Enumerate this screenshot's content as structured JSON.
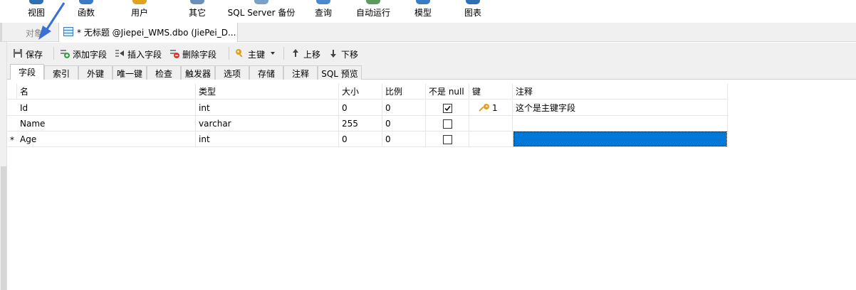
{
  "ribbon": {
    "items": [
      {
        "label": "视图",
        "icon": "view-icon"
      },
      {
        "label": "函数",
        "icon": "function-icon"
      },
      {
        "label": "用户",
        "icon": "user-icon"
      },
      {
        "label": "其它",
        "icon": "other-icon"
      },
      {
        "label": "SQL Server 备份",
        "icon": "backup-icon"
      },
      {
        "label": "查询",
        "icon": "query-icon"
      },
      {
        "label": "自动运行",
        "icon": "automation-icon"
      },
      {
        "label": "模型",
        "icon": "model-icon"
      },
      {
        "label": "图表",
        "icon": "chart-icon"
      }
    ]
  },
  "tabs": {
    "objects_label": "对象",
    "document_label": "* 无标题 @Jiepei_WMS.dbo (JiePei_D..."
  },
  "toolbar": {
    "save": "保存",
    "add_field": "添加字段",
    "insert_field": "插入字段",
    "delete_field": "删除字段",
    "primary_key": "主键",
    "move_up": "上移",
    "move_down": "下移"
  },
  "subtabs": [
    "字段",
    "索引",
    "外键",
    "唯一键",
    "检查",
    "触发器",
    "选项",
    "存储",
    "注释",
    "SQL 预览"
  ],
  "active_subtab": "字段",
  "grid": {
    "headers": {
      "name": "名",
      "type": "类型",
      "size": "大小",
      "scale": "比例",
      "not_null": "不是 null",
      "key": "键",
      "comment": "注释"
    },
    "rows": [
      {
        "marker": "",
        "name": "Id",
        "type": "int",
        "size": "0",
        "scale": "0",
        "not_null": true,
        "key": "1",
        "comment": "这个是主键字段"
      },
      {
        "marker": "",
        "name": "Name",
        "type": "varchar",
        "size": "255",
        "scale": "0",
        "not_null": false,
        "key": "",
        "comment": ""
      },
      {
        "marker": "*",
        "name": "Age",
        "type": "int",
        "size": "0",
        "scale": "0",
        "not_null": false,
        "key": "",
        "comment": ""
      }
    ]
  },
  "colors": {
    "selection": "#0078d7",
    "arrow": "#3a6fd8",
    "key_icon": "#e0a020"
  }
}
